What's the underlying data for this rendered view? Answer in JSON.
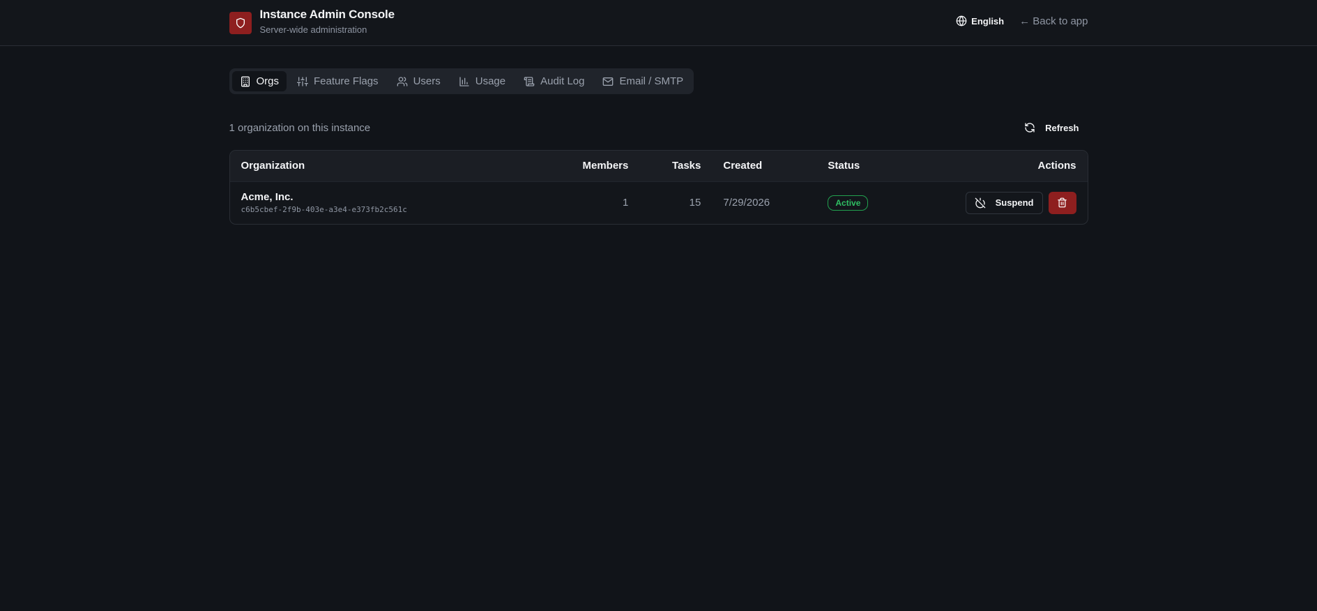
{
  "header": {
    "title": "Instance Admin Console",
    "subtitle": "Server-wide administration",
    "language": "English",
    "back_link": "← Back to app"
  },
  "tabs": [
    {
      "label": "Orgs",
      "icon": "building-icon",
      "active": true
    },
    {
      "label": "Feature Flags",
      "icon": "sliders-icon",
      "active": false
    },
    {
      "label": "Users",
      "icon": "users-icon",
      "active": false
    },
    {
      "label": "Usage",
      "icon": "bar-chart-icon",
      "active": false
    },
    {
      "label": "Audit Log",
      "icon": "scroll-icon",
      "active": false
    },
    {
      "label": "Email / SMTP",
      "icon": "mail-icon",
      "active": false
    }
  ],
  "summary": {
    "text": "1 organization on this instance",
    "refresh_label": "Refresh"
  },
  "table": {
    "columns": [
      "Organization",
      "Members",
      "Tasks",
      "Created",
      "Status",
      "Actions"
    ],
    "rows": [
      {
        "name": "Acme, Inc.",
        "id": "c6b5cbef-2f9b-403e-a3e4-e373fb2c561c",
        "members": "1",
        "tasks": "15",
        "created": "7/29/2026",
        "status": "Active",
        "suspend_label": "Suspend"
      }
    ]
  },
  "colors": {
    "background": "#111419",
    "brand": "#8e1f1f",
    "status_active": "#2fbf63"
  }
}
